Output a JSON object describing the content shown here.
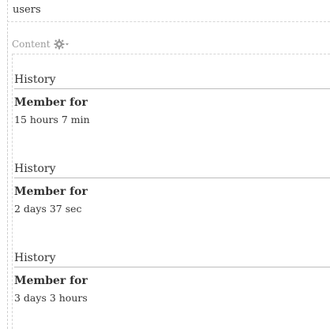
{
  "users_block": {
    "title": "users"
  },
  "content_region": {
    "label": "Content",
    "gear_icon": "gear-icon",
    "dropdown_icon": "chevron-down-icon"
  },
  "profiles": [
    {
      "history_title": "History",
      "member_label": "Member for",
      "member_value": "15 hours 7 min"
    },
    {
      "history_title": "History",
      "member_label": "Member for",
      "member_value": "2 days 37 sec"
    },
    {
      "history_title": "History",
      "member_label": "Member for",
      "member_value": "3 days 3 hours"
    }
  ]
}
